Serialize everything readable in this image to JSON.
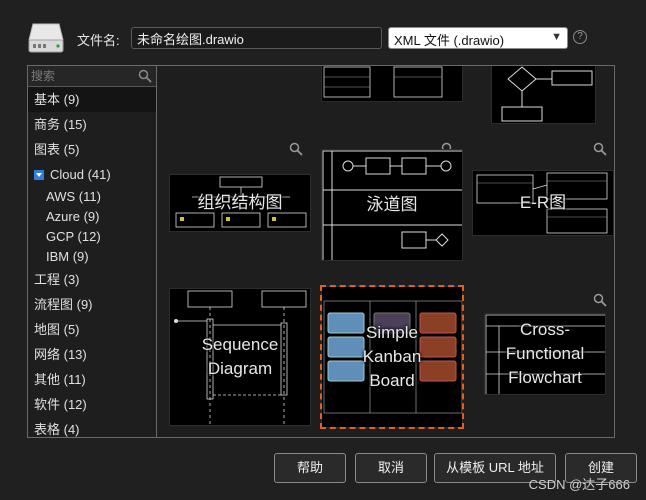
{
  "file": {
    "label": "文件名:",
    "value": "未命名绘图.drawio",
    "format": "XML 文件 (.drawio)",
    "help": "?"
  },
  "sidebar": {
    "search_placeholder": "搜索",
    "categories": [
      {
        "label": "基本 (9)",
        "selected": true
      },
      {
        "label": "商务 (15)"
      },
      {
        "label": "图表 (5)"
      },
      {
        "label": "Cloud (41)",
        "expanded": true
      },
      {
        "label": "AWS (11)",
        "sub": true
      },
      {
        "label": "Azure (9)",
        "sub": true
      },
      {
        "label": "GCP (12)",
        "sub": true
      },
      {
        "label": "IBM (9)",
        "sub": true
      },
      {
        "label": "工程 (3)"
      },
      {
        "label": "流程图 (9)"
      },
      {
        "label": "地图 (5)"
      },
      {
        "label": "网络 (13)"
      },
      {
        "label": "其他 (11)"
      },
      {
        "label": "软件 (12)"
      },
      {
        "label": "表格 (4)"
      }
    ]
  },
  "templates": {
    "org": "组织结构图",
    "swimlane": "泳道图",
    "er": "E-R图",
    "sequence": "Sequence\nDiagram",
    "kanban": "Simple\nKanban\nBoard",
    "crossfunc": "Cross-\nFunctional\nFlowchart"
  },
  "buttons": {
    "help": "帮助",
    "cancel": "取消",
    "from_url": "从模板 URL 地址",
    "create": "创建"
  },
  "watermark": "CSDN @达子666",
  "colors": {
    "accent_selected": "#e06020",
    "cloud_toggle": "#2f7fd8"
  }
}
